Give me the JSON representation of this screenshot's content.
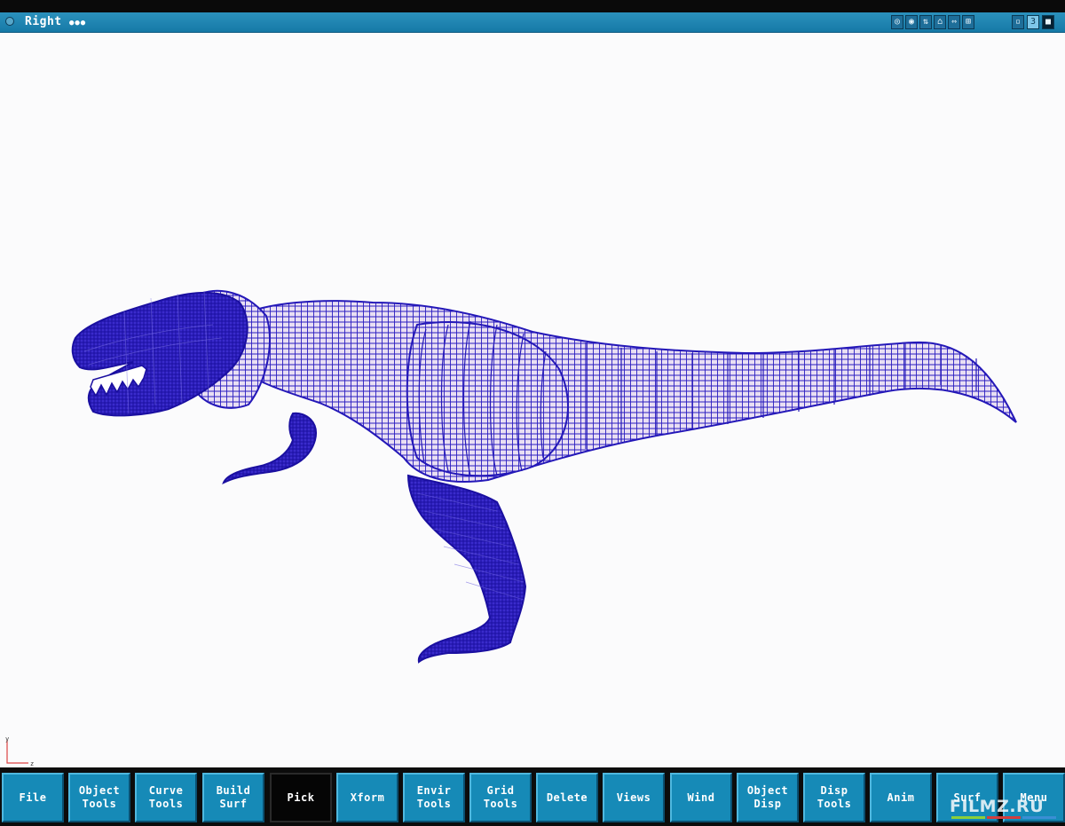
{
  "window": {
    "title": "Right",
    "title_dots": "●●●",
    "titlebar_color": "#1a80ad",
    "background": "#fbfbfc"
  },
  "titlebar_icons": [
    {
      "name": "zoom-icon",
      "glyph": "◎"
    },
    {
      "name": "camera-icon",
      "glyph": "◉"
    },
    {
      "name": "dolly-icon",
      "glyph": "⇅"
    },
    {
      "name": "home-icon",
      "glyph": "⌂"
    },
    {
      "name": "expand-icon",
      "glyph": "⇔"
    },
    {
      "name": "track-icon",
      "glyph": "⊞"
    }
  ],
  "titlebar_right_icons": [
    {
      "name": "minimize-icon",
      "glyph": "▫"
    },
    {
      "name": "window-number-icon",
      "glyph": "3"
    },
    {
      "name": "maximize-icon",
      "glyph": "■"
    }
  ],
  "viewport": {
    "model": "t-rex wireframe",
    "mesh_color": "#2418b8",
    "axis_labels": {
      "vertical": "y",
      "horizontal": "z"
    }
  },
  "menu": {
    "background": "#168ab7",
    "active_background": "#050505",
    "buttons": [
      {
        "label": "File",
        "name": "file"
      },
      {
        "label": "Object\nTools",
        "name": "object-tools"
      },
      {
        "label": "Curve\nTools",
        "name": "curve-tools"
      },
      {
        "label": "Build\nSurf",
        "name": "build-surf"
      },
      {
        "label": "Pick",
        "name": "pick",
        "active": true
      },
      {
        "label": "Xform",
        "name": "xform"
      },
      {
        "label": "Envir\nTools",
        "name": "envir-tools"
      },
      {
        "label": "Grid\nTools",
        "name": "grid-tools"
      },
      {
        "label": "Delete",
        "name": "delete"
      },
      {
        "label": "Views",
        "name": "views"
      },
      {
        "label": "Wind",
        "name": "wind"
      },
      {
        "label": "Object\nDisp",
        "name": "object-disp"
      },
      {
        "label": "Disp\nTools",
        "name": "disp-tools"
      },
      {
        "label": "Anim",
        "name": "anim"
      },
      {
        "label": "Surf",
        "name": "surf"
      },
      {
        "label": "Menu",
        "name": "menu"
      }
    ]
  },
  "watermark": {
    "text": "FILMZ.RU"
  }
}
